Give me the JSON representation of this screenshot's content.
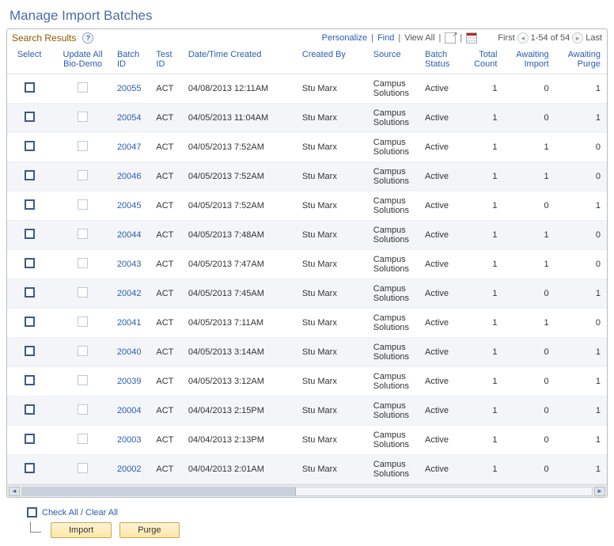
{
  "page_title": "Manage Import Batches",
  "grid_header": {
    "search_results": "Search Results",
    "personalize": "Personalize",
    "find": "Find",
    "view_all": "View All",
    "first": "First",
    "range": "1-54 of 54",
    "last": "Last"
  },
  "columns": {
    "select": "Select",
    "update_all": "Update All Bio-Demo",
    "batch_id": "Batch ID",
    "test_id": "Test ID",
    "datetime": "Date/Time Created",
    "created_by": "Created By",
    "source": "Source",
    "batch_status": "Batch Status",
    "total_count": "Total Count",
    "awaiting_import": "Awaiting Import",
    "awaiting_purge": "Awaiting Purge"
  },
  "rows": [
    {
      "batch_id": "20055",
      "test_id": "ACT",
      "dt": "04/08/2013 12:11AM",
      "cb": "Stu Marx",
      "src": "Campus Solutions",
      "status": "Active",
      "count": 1,
      "ai": 0,
      "ap": 1
    },
    {
      "batch_id": "20054",
      "test_id": "ACT",
      "dt": "04/05/2013 11:04AM",
      "cb": "Stu Marx",
      "src": "Campus Solutions",
      "status": "Active",
      "count": 1,
      "ai": 0,
      "ap": 1
    },
    {
      "batch_id": "20047",
      "test_id": "ACT",
      "dt": "04/05/2013  7:52AM",
      "cb": "Stu Marx",
      "src": "Campus Solutions",
      "status": "Active",
      "count": 1,
      "ai": 1,
      "ap": 0
    },
    {
      "batch_id": "20046",
      "test_id": "ACT",
      "dt": "04/05/2013  7:52AM",
      "cb": "Stu Marx",
      "src": "Campus Solutions",
      "status": "Active",
      "count": 1,
      "ai": 1,
      "ap": 0
    },
    {
      "batch_id": "20045",
      "test_id": "ACT",
      "dt": "04/05/2013  7:52AM",
      "cb": "Stu Marx",
      "src": "Campus Solutions",
      "status": "Active",
      "count": 1,
      "ai": 0,
      "ap": 1
    },
    {
      "batch_id": "20044",
      "test_id": "ACT",
      "dt": "04/05/2013  7:48AM",
      "cb": "Stu Marx",
      "src": "Campus Solutions",
      "status": "Active",
      "count": 1,
      "ai": 1,
      "ap": 0
    },
    {
      "batch_id": "20043",
      "test_id": "ACT",
      "dt": "04/05/2013  7:47AM",
      "cb": "Stu Marx",
      "src": "Campus Solutions",
      "status": "Active",
      "count": 1,
      "ai": 1,
      "ap": 0
    },
    {
      "batch_id": "20042",
      "test_id": "ACT",
      "dt": "04/05/2013  7:45AM",
      "cb": "Stu Marx",
      "src": "Campus Solutions",
      "status": "Active",
      "count": 1,
      "ai": 0,
      "ap": 1
    },
    {
      "batch_id": "20041",
      "test_id": "ACT",
      "dt": "04/05/2013  7:11AM",
      "cb": "Stu Marx",
      "src": "Campus Solutions",
      "status": "Active",
      "count": 1,
      "ai": 1,
      "ap": 0
    },
    {
      "batch_id": "20040",
      "test_id": "ACT",
      "dt": "04/05/2013  3:14AM",
      "cb": "Stu Marx",
      "src": "Campus Solutions",
      "status": "Active",
      "count": 1,
      "ai": 0,
      "ap": 1
    },
    {
      "batch_id": "20039",
      "test_id": "ACT",
      "dt": "04/05/2013  3:12AM",
      "cb": "Stu Marx",
      "src": "Campus Solutions",
      "status": "Active",
      "count": 1,
      "ai": 0,
      "ap": 1
    },
    {
      "batch_id": "20004",
      "test_id": "ACT",
      "dt": "04/04/2013  2:15PM",
      "cb": "Stu Marx",
      "src": "Campus Solutions",
      "status": "Active",
      "count": 1,
      "ai": 0,
      "ap": 1
    },
    {
      "batch_id": "20003",
      "test_id": "ACT",
      "dt": "04/04/2013  2:13PM",
      "cb": "Stu Marx",
      "src": "Campus Solutions",
      "status": "Active",
      "count": 1,
      "ai": 0,
      "ap": 1
    },
    {
      "batch_id": "20002",
      "test_id": "ACT",
      "dt": "04/04/2013  2:01AM",
      "cb": "Stu Marx",
      "src": "Campus Solutions",
      "status": "Active",
      "count": 1,
      "ai": 0,
      "ap": 1
    }
  ],
  "footer": {
    "check_all": "Check All / Clear All",
    "import_btn": "Import",
    "purge_btn": "Purge"
  }
}
